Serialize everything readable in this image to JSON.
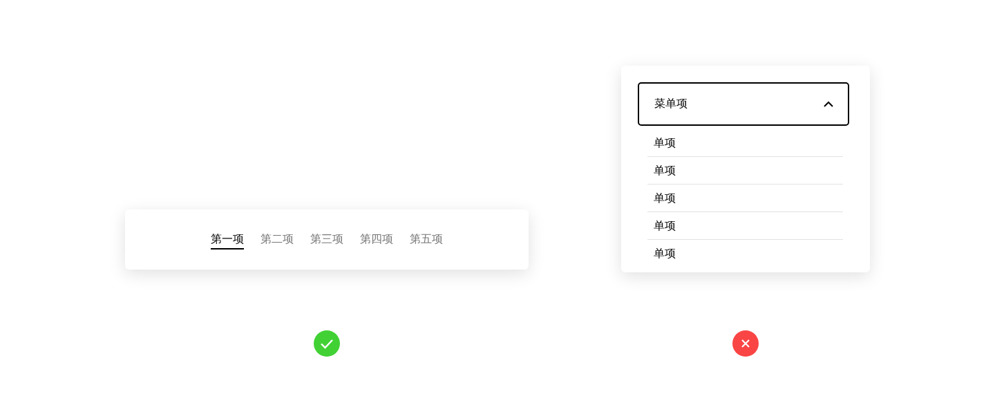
{
  "examples": [
    {
      "tabs": [
        {
          "label": "第一项",
          "selected": true
        },
        {
          "label": "第二项",
          "selected": false
        },
        {
          "label": "第三项",
          "selected": false
        },
        {
          "label": "第四项",
          "selected": false
        },
        {
          "label": "第五项",
          "selected": false
        }
      ],
      "verdict": {
        "kind": "correct"
      }
    },
    {
      "dropdown": {
        "label": "菜单项",
        "expanded": true,
        "items": [
          "单项",
          "单项",
          "单项",
          "单项",
          "单项"
        ]
      },
      "verdict": {
        "kind": "wrong"
      }
    }
  ]
}
